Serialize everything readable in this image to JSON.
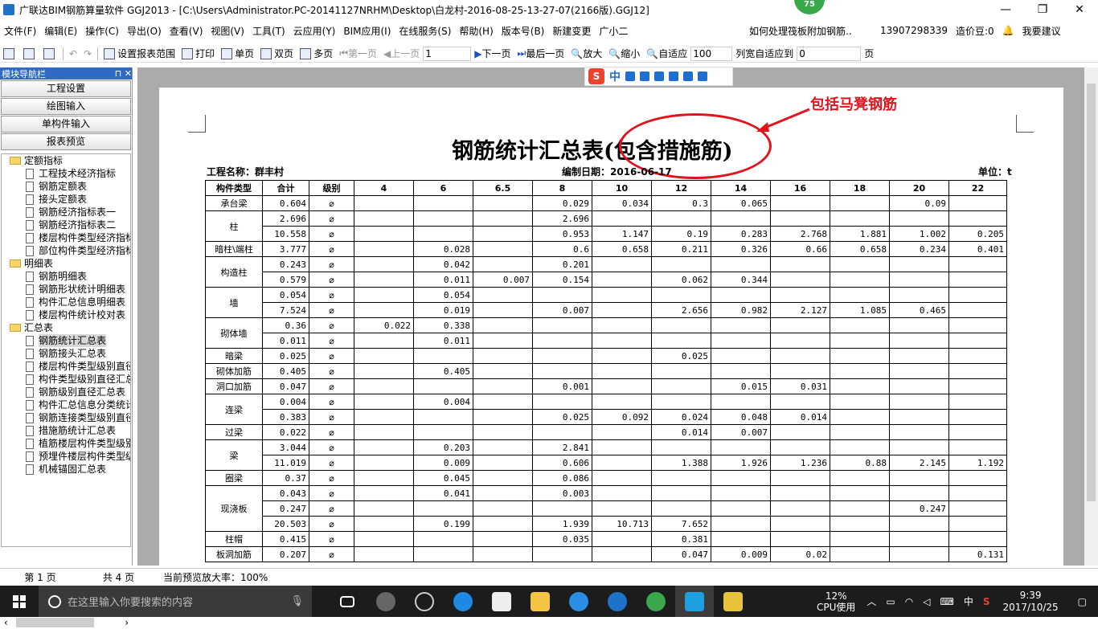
{
  "window": {
    "title": "广联达BIM钢筋算量软件 GGJ2013 - [C:\\Users\\Administrator.PC-20141127NRHM\\Desktop\\白龙村-2016-08-25-13-27-07(2166版).GGJ12]",
    "badge": "75",
    "minimize": "—",
    "restore": "❐",
    "close": "✕"
  },
  "menu": {
    "items": [
      "文件(F)",
      "编辑(E)",
      "操作(C)",
      "导出(O)",
      "查看(V)",
      "视图(V)",
      "工具(T)",
      "云应用(Y)",
      "BIM应用(I)",
      "在线服务(S)",
      "帮助(H)",
      "版本号(B)",
      "新建变更",
      "广小二"
    ],
    "tip": "如何处理筏板附加钢筋..",
    "phone": "13907298339",
    "credits": "造价豆:0",
    "suggest": "我要建议"
  },
  "toolbar": {
    "set_range": "设置报表范围",
    "print": "打印",
    "single": "单页",
    "double": "双页",
    "multi": "多页",
    "first": "第一页",
    "prev": "上一页",
    "page_value": "1",
    "next": "下一页",
    "last": "最后一页",
    "zoom_in": "放大",
    "zoom_out": "缩小",
    "fit": "自适应",
    "zoom_value": "100",
    "fit_width": "列宽自适应到",
    "fit_width_value": "0",
    "page_unit": "页"
  },
  "nav": {
    "header": "模块导航栏",
    "pin": "⊓",
    "close": "✕",
    "buttons": [
      "工程设置",
      "绘图输入",
      "单构件输入",
      "报表预览"
    ],
    "tree": [
      {
        "type": "folder",
        "label": "定额指标"
      },
      {
        "type": "doc",
        "label": "工程技术经济指标"
      },
      {
        "type": "doc",
        "label": "钢筋定额表"
      },
      {
        "type": "doc",
        "label": "接头定额表"
      },
      {
        "type": "doc",
        "label": "钢筋经济指标表一"
      },
      {
        "type": "doc",
        "label": "钢筋经济指标表二"
      },
      {
        "type": "doc",
        "label": "楼层构件类型经济指标"
      },
      {
        "type": "doc",
        "label": "部位构件类型经济指标"
      },
      {
        "type": "folder",
        "label": "明细表"
      },
      {
        "type": "doc",
        "label": "钢筋明细表"
      },
      {
        "type": "doc",
        "label": "钢筋形状统计明细表"
      },
      {
        "type": "doc",
        "label": "构件汇总信息明细表"
      },
      {
        "type": "doc",
        "label": "楼层构件统计校对表"
      },
      {
        "type": "folder",
        "label": "汇总表"
      },
      {
        "type": "doc",
        "label": "钢筋统计汇总表",
        "selected": true
      },
      {
        "type": "doc",
        "label": "钢筋接头汇总表"
      },
      {
        "type": "doc",
        "label": "楼层构件类型级别直径"
      },
      {
        "type": "doc",
        "label": "构件类型级别直径汇总"
      },
      {
        "type": "doc",
        "label": "钢筋级别直径汇总表"
      },
      {
        "type": "doc",
        "label": "构件汇总信息分类统计"
      },
      {
        "type": "doc",
        "label": "钢筋连接类型级别直径"
      },
      {
        "type": "doc",
        "label": "措施筋统计汇总表"
      },
      {
        "type": "doc",
        "label": "植筋楼层构件类型级别"
      },
      {
        "type": "doc",
        "label": "预埋件楼层构件类型级"
      },
      {
        "type": "doc",
        "label": "机械锚固汇总表"
      }
    ]
  },
  "report": {
    "title": "钢筋统计汇总表(包含措施筋)",
    "annotation": "包括马凳钢筋",
    "project_label": "工程名称：群丰村",
    "date_label": "编制日期：2016-06-17",
    "unit_label": "单位：t",
    "headers": [
      "构件类型",
      "合计",
      "级别",
      "4",
      "6",
      "6.5",
      "8",
      "10",
      "12",
      "14",
      "16",
      "18",
      "20",
      "22"
    ],
    "rows": [
      {
        "name": "承台梁",
        "span": 1,
        "cells": [
          "0.604",
          "⌀",
          "",
          "",
          "",
          "0.029",
          "0.034",
          "0.3",
          "0.065",
          "",
          "",
          "0.09",
          ""
        ]
      },
      {
        "name": "柱",
        "span": 2,
        "cells": [
          "2.696",
          "⌀",
          "",
          "",
          "",
          "2.696",
          "",
          "",
          "",
          "",
          "",
          "",
          ""
        ]
      },
      {
        "name": "",
        "span": 0,
        "cells": [
          "10.558",
          "⌀",
          "",
          "",
          "",
          "0.953",
          "1.147",
          "0.19",
          "0.283",
          "2.768",
          "1.881",
          "1.002",
          "0.205"
        ]
      },
      {
        "name": "暗柱\\端柱",
        "span": 1,
        "cells": [
          "3.777",
          "⌀",
          "",
          "0.028",
          "",
          "0.6",
          "0.658",
          "0.211",
          "0.326",
          "0.66",
          "0.658",
          "0.234",
          "0.401"
        ]
      },
      {
        "name": "构造柱",
        "span": 2,
        "cells": [
          "0.243",
          "⌀",
          "",
          "0.042",
          "",
          "0.201",
          "",
          "",
          "",
          "",
          "",
          "",
          ""
        ]
      },
      {
        "name": "",
        "span": 0,
        "cells": [
          "0.579",
          "⌀",
          "",
          "0.011",
          "0.007",
          "0.154",
          "",
          "0.062",
          "0.344",
          "",
          "",
          "",
          ""
        ]
      },
      {
        "name": "墙",
        "span": 2,
        "cells": [
          "0.054",
          "⌀",
          "",
          "0.054",
          "",
          "",
          "",
          "",
          "",
          "",
          "",
          "",
          ""
        ]
      },
      {
        "name": "",
        "span": 0,
        "cells": [
          "7.524",
          "⌀",
          "",
          "0.019",
          "",
          "0.007",
          "",
          "2.656",
          "0.982",
          "2.127",
          "1.085",
          "0.465",
          ""
        ]
      },
      {
        "name": "砌体墙",
        "span": 2,
        "cells": [
          "0.36",
          "⌀",
          "0.022",
          "0.338",
          "",
          "",
          "",
          "",
          "",
          "",
          "",
          "",
          ""
        ]
      },
      {
        "name": "",
        "span": 0,
        "cells": [
          "0.011",
          "⌀",
          "",
          "0.011",
          "",
          "",
          "",
          "",
          "",
          "",
          "",
          "",
          ""
        ]
      },
      {
        "name": "暗梁",
        "span": 1,
        "cells": [
          "0.025",
          "⌀",
          "",
          "",
          "",
          "",
          "",
          "0.025",
          "",
          "",
          "",
          "",
          ""
        ]
      },
      {
        "name": "砌体加筋",
        "span": 1,
        "cells": [
          "0.405",
          "⌀",
          "",
          "0.405",
          "",
          "",
          "",
          "",
          "",
          "",
          "",
          "",
          ""
        ]
      },
      {
        "name": "洞口加筋",
        "span": 1,
        "cells": [
          "0.047",
          "⌀",
          "",
          "",
          "",
          "0.001",
          "",
          "",
          "0.015",
          "0.031",
          "",
          "",
          ""
        ]
      },
      {
        "name": "连梁",
        "span": 2,
        "cells": [
          "0.004",
          "⌀",
          "",
          "0.004",
          "",
          "",
          "",
          "",
          "",
          "",
          "",
          "",
          ""
        ]
      },
      {
        "name": "",
        "span": 0,
        "cells": [
          "0.383",
          "⌀",
          "",
          "",
          "",
          "0.025",
          "0.092",
          "0.024",
          "0.048",
          "0.014",
          "",
          "",
          ""
        ]
      },
      {
        "name": "过梁",
        "span": 1,
        "cells": [
          "0.022",
          "⌀",
          "",
          "",
          "",
          "",
          "",
          "0.014",
          "0.007",
          "",
          "",
          "",
          ""
        ]
      },
      {
        "name": "梁",
        "span": 2,
        "cells": [
          "3.044",
          "⌀",
          "",
          "0.203",
          "",
          "2.841",
          "",
          "",
          "",
          "",
          "",
          "",
          ""
        ]
      },
      {
        "name": "",
        "span": 0,
        "cells": [
          "11.019",
          "⌀",
          "",
          "0.009",
          "",
          "0.606",
          "",
          "1.388",
          "1.926",
          "1.236",
          "0.88",
          "2.145",
          "1.192"
        ]
      },
      {
        "name": "圈梁",
        "span": 1,
        "cells": [
          "0.37",
          "⌀",
          "",
          "0.045",
          "",
          "0.086",
          "",
          "",
          "",
          "",
          "",
          "",
          ""
        ]
      },
      {
        "name": "现浇板",
        "span": 3,
        "cells": [
          "0.043",
          "⌀",
          "",
          "0.041",
          "",
          "0.003",
          "",
          "",
          "",
          "",
          "",
          "",
          ""
        ]
      },
      {
        "name": "",
        "span": 0,
        "cells": [
          "0.247",
          "⌀",
          "",
          "",
          "",
          "",
          "",
          "",
          "",
          "",
          "",
          "0.247",
          ""
        ]
      },
      {
        "name": "",
        "span": 0,
        "cells": [
          "20.503",
          "⌀",
          "",
          "0.199",
          "",
          "1.939",
          "10.713",
          "7.652",
          "",
          "",
          "",
          "",
          ""
        ]
      },
      {
        "name": "柱帽",
        "span": 1,
        "cells": [
          "0.415",
          "⌀",
          "",
          "",
          "",
          "0.035",
          "",
          "0.381",
          "",
          "",
          "",
          "",
          ""
        ]
      },
      {
        "name": "板洞加筋",
        "span": 1,
        "cells": [
          "0.207",
          "⌀",
          "",
          "",
          "",
          "",
          "",
          "0.047",
          "0.009",
          "0.02",
          "",
          "",
          "0.131"
        ]
      }
    ]
  },
  "status": {
    "page": "第 1 页",
    "total": "共 4 页",
    "zoom": "当前预览放大率：100%"
  },
  "taskbar": {
    "search_placeholder": "在这里输入你要搜索的内容",
    "cpu_pct": "12%",
    "cpu_label": "CPU使用",
    "ime": "中",
    "time": "9:39",
    "date": "2017/10/25"
  },
  "colors": {
    "annotation_red": "#e0141e",
    "nav_header_blue": "#316ac5",
    "badge_green": "#3aa84a",
    "taskbar_bg": "#1c1c1c"
  }
}
